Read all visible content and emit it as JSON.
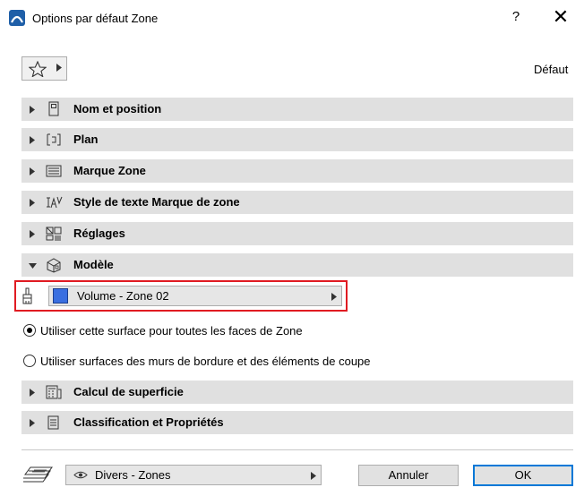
{
  "window": {
    "title": "Options par défaut Zone",
    "help_label": "?",
    "close_label": "✕"
  },
  "toolbar": {
    "favorites_icon": "star-icon",
    "default_label": "Défaut"
  },
  "sections": [
    {
      "label": "Nom et position",
      "icon": "name-position-icon",
      "expanded": false
    },
    {
      "label": "Plan",
      "icon": "floor-plan-icon",
      "expanded": false
    },
    {
      "label": "Marque Zone",
      "icon": "zone-stamp-icon",
      "expanded": false
    },
    {
      "label": "Style de texte Marque de zone",
      "icon": "text-style-icon",
      "expanded": false
    },
    {
      "label": "Réglages",
      "icon": "settings-icon",
      "expanded": false
    },
    {
      "label": "Modèle",
      "icon": "model-icon",
      "expanded": true
    },
    {
      "label": "Calcul de superficie",
      "icon": "area-calc-icon",
      "expanded": false
    },
    {
      "label": "Classification et Propriétés",
      "icon": "classification-icon",
      "expanded": false
    }
  ],
  "model": {
    "surface_label": "Volume - Zone 02",
    "surface_color": "#3a6fe0",
    "options": [
      {
        "label": "Utiliser cette surface pour toutes les faces de Zone",
        "checked": true
      },
      {
        "label": "Utiliser surfaces des murs de bordure et des éléments de coupe",
        "checked": false
      }
    ]
  },
  "footer": {
    "layer_label": "Divers - Zones",
    "cancel_label": "Annuler",
    "ok_label": "OK"
  },
  "colors": {
    "section_bg": "#e0e0e0",
    "highlight_border": "#e01b22",
    "ok_border": "#0078d7"
  }
}
